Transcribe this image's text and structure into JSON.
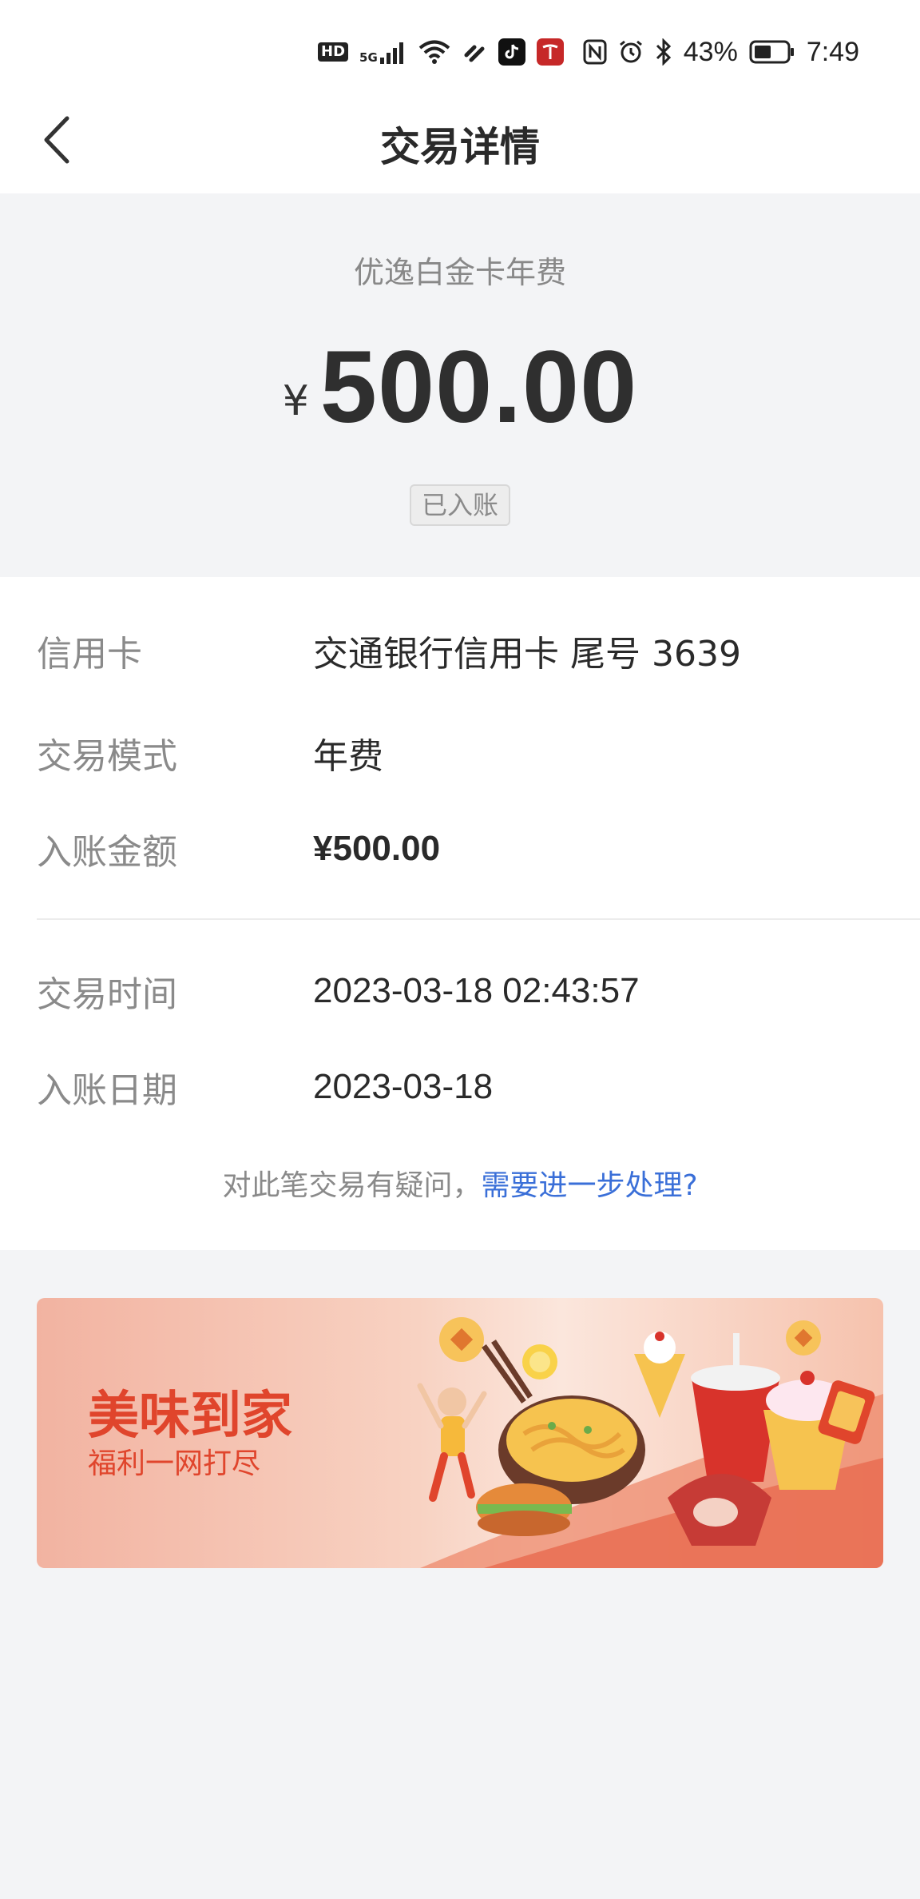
{
  "status_bar": {
    "network": "5G",
    "battery_percent": "43%",
    "time": "7:49"
  },
  "navbar": {
    "title": "交易详情"
  },
  "summary": {
    "merchant": "优逸白金卡年费",
    "currency_symbol": "¥",
    "amount": "500.00",
    "status": "已入账"
  },
  "details": {
    "rows": [
      {
        "label": "信用卡",
        "value": "交通银行信用卡 尾号 3639"
      },
      {
        "label": "交易模式",
        "value": "年费"
      },
      {
        "label": "入账金额",
        "value": "¥500.00"
      },
      {
        "label": "交易时间",
        "value": "2023-03-18 02:43:57"
      },
      {
        "label": "入账日期",
        "value": "2023-03-18"
      }
    ],
    "help_text": "对此笔交易有疑问，",
    "help_link": "需要进一步处理?"
  },
  "banner": {
    "title": "美味到家",
    "subtitle": "福利一网打尽"
  },
  "colors": {
    "accent_link": "#3a6fd8",
    "banner_red": "#e0452c"
  }
}
